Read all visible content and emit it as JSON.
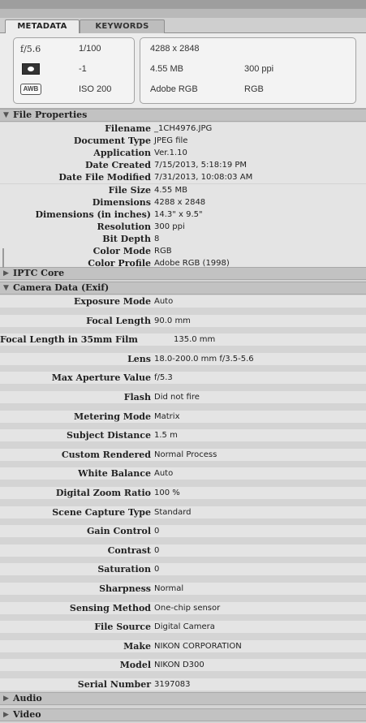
{
  "tabs": [
    {
      "label": "METADATA"
    },
    {
      "label": "KEYWORDS"
    }
  ],
  "summary": {
    "camera": {
      "aperture": "f/5.6",
      "shutter": "1/100",
      "metering_icon": "metering-matrix-icon",
      "exposure_comp": "-1",
      "white_balance_icon": "AWB",
      "iso": "ISO 200"
    },
    "file": {
      "dimensions": "4288 x 2848",
      "size": "4.55 MB",
      "resolution": "300 ppi",
      "color_profile": "Adobe RGB",
      "color_mode": "RGB"
    }
  },
  "sections": {
    "file_properties": {
      "title": "File Properties",
      "rows": [
        {
          "label": "Filename",
          "value": "_1CH4976.JPG"
        },
        {
          "label": "Document Type",
          "value": "JPEG file"
        },
        {
          "label": "Application",
          "value": "Ver.1.10"
        },
        {
          "label": "Date Created",
          "value": "7/15/2013, 5:18:19 PM"
        },
        {
          "label": "Date File Modified",
          "value": "7/31/2013, 10:08:03 AM"
        },
        {
          "label": "File Size",
          "value": "4.55 MB"
        },
        {
          "label": "Dimensions",
          "value": "4288 x 2848"
        },
        {
          "label": "Dimensions (in inches)",
          "value": "14.3\" x 9.5\""
        },
        {
          "label": "Resolution",
          "value": "300 ppi"
        },
        {
          "label": "Bit Depth",
          "value": "8"
        },
        {
          "label": "Color Mode",
          "value": "RGB"
        },
        {
          "label": "Color Profile",
          "value": "Adobe RGB (1998)"
        }
      ]
    },
    "iptc_core": {
      "title": "IPTC Core"
    },
    "camera_data": {
      "title": "Camera Data (Exif)",
      "rows": [
        {
          "label": "Exposure Mode",
          "value": "Auto"
        },
        {
          "label": "Focal Length",
          "value": "90.0 mm"
        },
        {
          "label": "Focal Length in 35mm Film",
          "value": "135.0 mm"
        },
        {
          "label": "Lens",
          "value": "18.0-200.0 mm f/3.5-5.6"
        },
        {
          "label": "Max Aperture Value",
          "value": "f/5.3"
        },
        {
          "label": "Flash",
          "value": "Did not fire"
        },
        {
          "label": "Metering Mode",
          "value": "Matrix"
        },
        {
          "label": "Subject Distance",
          "value": "1.5 m"
        },
        {
          "label": "Custom Rendered",
          "value": "Normal Process"
        },
        {
          "label": "White Balance",
          "value": "Auto"
        },
        {
          "label": "Digital Zoom Ratio",
          "value": "100 %"
        },
        {
          "label": "Scene Capture Type",
          "value": "Standard"
        },
        {
          "label": "Gain Control",
          "value": "0"
        },
        {
          "label": "Contrast",
          "value": "0"
        },
        {
          "label": "Saturation",
          "value": "0"
        },
        {
          "label": "Sharpness",
          "value": "Normal"
        },
        {
          "label": "Sensing Method",
          "value": "One-chip sensor"
        },
        {
          "label": "File Source",
          "value": "Digital Camera"
        },
        {
          "label": "Make",
          "value": "NIKON CORPORATION"
        },
        {
          "label": "Model",
          "value": "NIKON D300"
        },
        {
          "label": "Serial Number",
          "value": "3197083"
        }
      ]
    },
    "audio": {
      "title": "Audio"
    },
    "video": {
      "title": "Video"
    }
  },
  "colors": {
    "panel_bg": "#e4e4e4",
    "section_header_bg": "#c2c2c2",
    "tab_active_bg": "#ececec"
  }
}
